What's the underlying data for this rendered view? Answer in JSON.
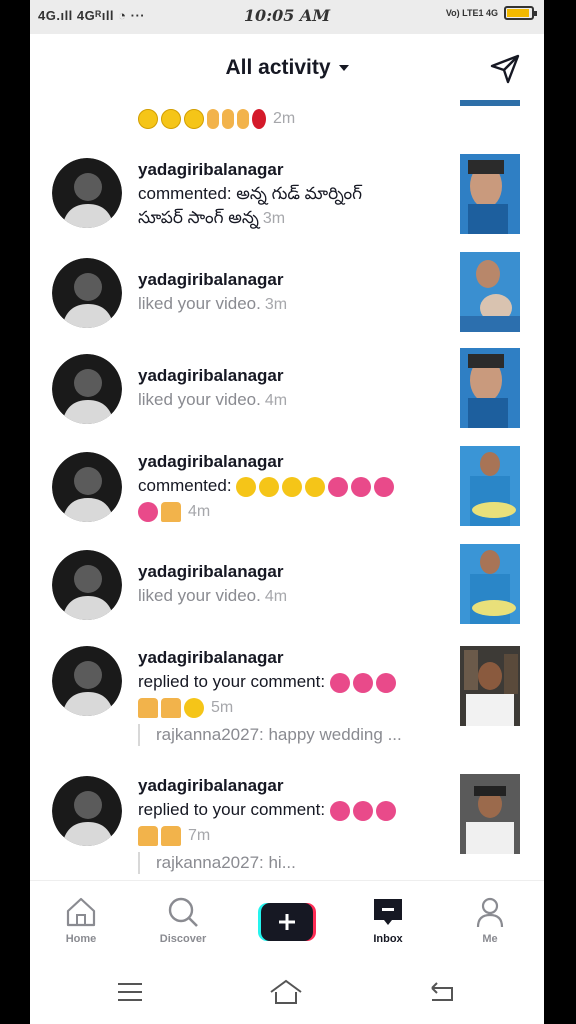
{
  "status": {
    "left": "4G.ıll 4Gᴿıll ◔ ···",
    "time": "10:05 AM",
    "right": "Vo) LTE1 4G",
    "battery_level": 0.9,
    "battery_color": "#f2b900"
  },
  "header": {
    "title": "All activity",
    "filter_icon": "send-filter-icon"
  },
  "activities": [
    {
      "username": "",
      "text": "",
      "time": "2m",
      "emoji": [
        "laugh",
        "laugh",
        "laugh",
        "ok",
        "ok",
        "ok",
        "rose"
      ],
      "style": "partial"
    },
    {
      "username": "yadagiribalanagar",
      "text_line1": "commented: అన్న గుడ్ మార్నింగ్",
      "text_line2": "సూపర్ సాంగ్ అన్న",
      "time": "3m"
    },
    {
      "username": "yadagiribalanagar",
      "text": "liked your video.",
      "time": "3m"
    },
    {
      "username": "yadagiribalanagar",
      "text": "liked your video.",
      "time": "4m"
    },
    {
      "username": "yadagiribalanagar",
      "text": "commented:",
      "time": "4m"
    },
    {
      "username": "yadagiribalanagar",
      "text": "liked your video.",
      "time": "4m"
    },
    {
      "username": "yadagiribalanagar",
      "text": "replied to your comment:",
      "time": "5m",
      "reply": "rajkanna2027: happy wedding ..."
    },
    {
      "username": "yadagiribalanagar",
      "text": "replied to your comment:",
      "time": "7m",
      "reply": "rajkanna2027: hi..."
    }
  ],
  "nav": {
    "home": "Home",
    "discover": "Discover",
    "inbox": "Inbox",
    "me": "Me"
  },
  "colors": {
    "primary_text": "#161823",
    "secondary_text": "#8a8b91",
    "plus_left": "#25f4ee",
    "plus_right": "#fe2c55"
  }
}
